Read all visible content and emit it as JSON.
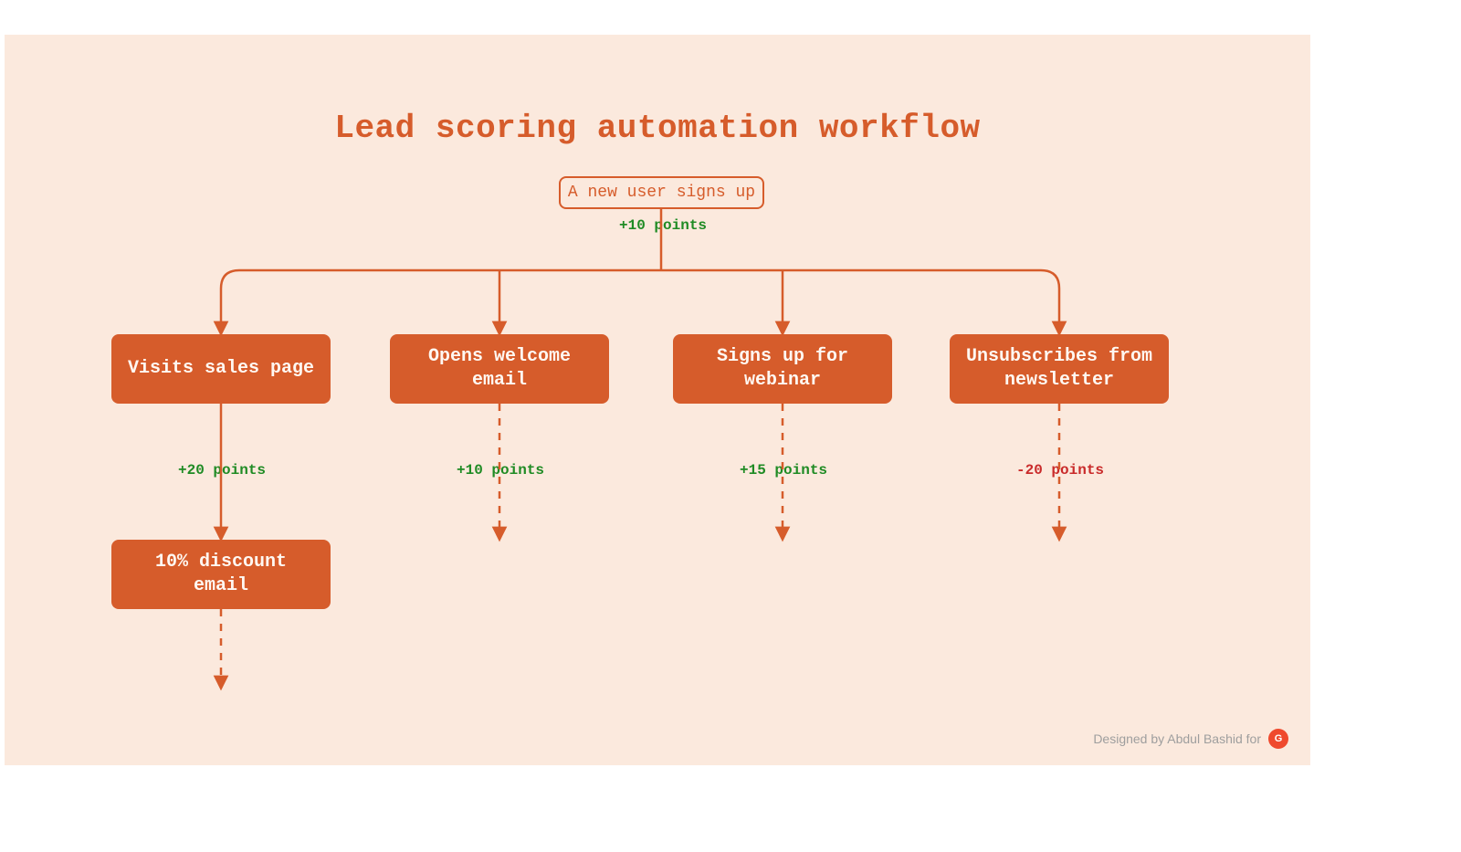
{
  "title": "Lead scoring automation workflow",
  "start": {
    "label": "A new user signs up",
    "points": "+10 points"
  },
  "branches": [
    {
      "label": "Visits sales page",
      "points": "+20 points",
      "positive": true,
      "followup": "10% discount email"
    },
    {
      "label": "Opens welcome email",
      "points": "+10 points",
      "positive": true,
      "followup": null
    },
    {
      "label": "Signs up for webinar",
      "points": "+15 points",
      "positive": true,
      "followup": null
    },
    {
      "label": "Unsubscribes from newsletter",
      "points": "-20 points",
      "positive": false,
      "followup": null
    }
  ],
  "credit": "Designed by Abdul Bashid for",
  "colors": {
    "accent": "#D65C2B",
    "bg": "#FBE9DD",
    "positive": "#1F8B24",
    "negative": "#C92A2A"
  }
}
